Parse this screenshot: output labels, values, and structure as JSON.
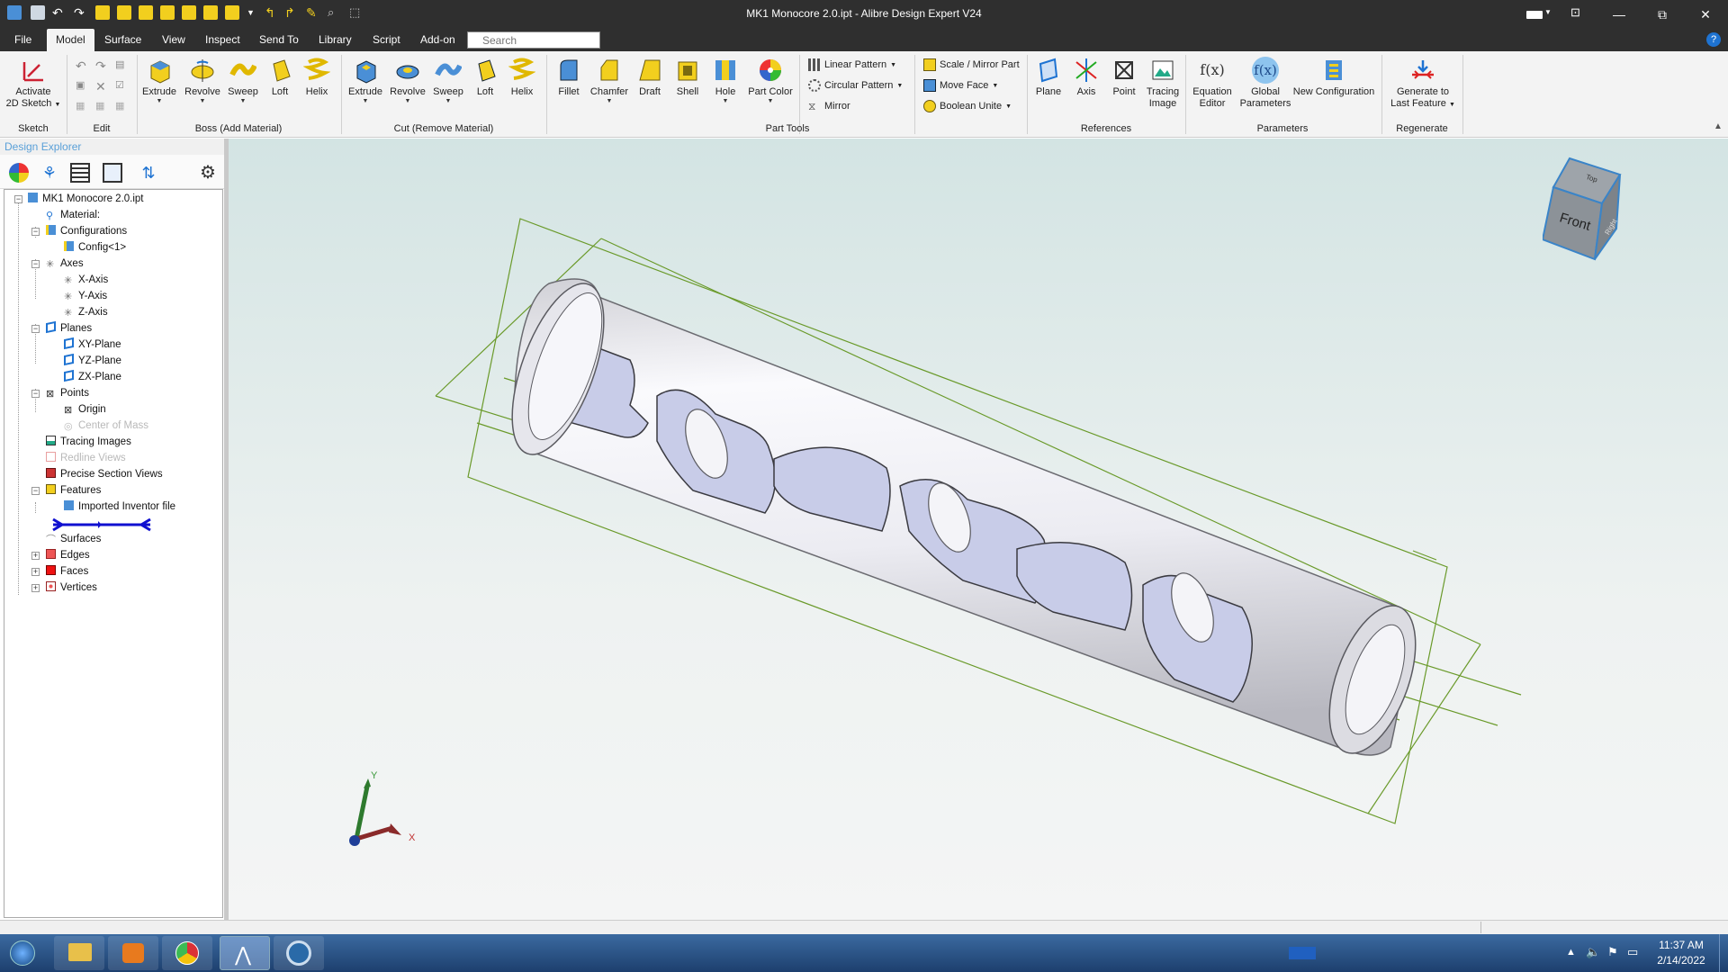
{
  "window": {
    "title": "MK1 Monocore 2.0.ipt - Alibre Design Expert V24",
    "controls": [
      "—",
      "⧉",
      "✕"
    ]
  },
  "menu": {
    "items": [
      "File",
      "Model",
      "Surface",
      "View",
      "Inspect",
      "Send To",
      "Library",
      "Script",
      "Add-on"
    ],
    "active": "Model",
    "search_placeholder": "Search"
  },
  "ribbon": {
    "sketch": {
      "activate_label": "Activate",
      "activate_label2": "2D Sketch"
    },
    "groups": [
      "Sketch",
      "Edit",
      "Boss (Add Material)",
      "Cut (Remove Material)",
      "Part Tools",
      "References",
      "Parameters",
      "Regenerate"
    ],
    "boss": [
      "Extrude",
      "Revolve",
      "Sweep",
      "Loft",
      "Helix"
    ],
    "cut": [
      "Extrude",
      "Revolve",
      "Sweep",
      "Loft",
      "Helix"
    ],
    "part_tools": [
      "Fillet",
      "Chamfer",
      "Draft",
      "Shell",
      "Hole",
      "Part Color"
    ],
    "pattern_tools": [
      "Linear Pattern",
      "Circular Pattern",
      "Mirror"
    ],
    "move_tools": [
      "Scale / Mirror Part",
      "Move Face",
      "Boolean Unite"
    ],
    "references": [
      "Plane",
      "Axis",
      "Point",
      "Tracing",
      "Image"
    ],
    "parameters": [
      "Equation",
      "Editor",
      "Global",
      "Parameters",
      "New Configuration"
    ],
    "regenerate": [
      "Generate to",
      "Last Feature"
    ]
  },
  "explorer": {
    "title": "Design Explorer",
    "tree": [
      {
        "label": "MK1 Monocore 2.0.ipt"
      },
      {
        "label": "Material:"
      },
      {
        "label": "Configurations"
      },
      {
        "label": "Config<1>"
      },
      {
        "label": "Axes"
      },
      {
        "label": "X-Axis"
      },
      {
        "label": "Y-Axis"
      },
      {
        "label": "Z-Axis"
      },
      {
        "label": "Planes"
      },
      {
        "label": "XY-Plane"
      },
      {
        "label": "YZ-Plane"
      },
      {
        "label": "ZX-Plane"
      },
      {
        "label": "Points"
      },
      {
        "label": "Origin"
      },
      {
        "label": "Center of Mass"
      },
      {
        "label": "Tracing Images"
      },
      {
        "label": "Redline Views"
      },
      {
        "label": "Precise Section Views"
      },
      {
        "label": "Features"
      },
      {
        "label": "Imported Inventor file"
      },
      {
        "label": "Surfaces"
      },
      {
        "label": "Edges"
      },
      {
        "label": "Faces"
      },
      {
        "label": "Vertices"
      }
    ]
  },
  "viewcube": {
    "front": "Front",
    "right": "Right",
    "top": "Top"
  },
  "triad": {
    "x": "X",
    "y": "Y"
  },
  "taskbar": {
    "time": "11:37 AM",
    "date": "2/14/2022"
  },
  "colors": {
    "accent": "#1e73d2",
    "titlebar": "#2f2f2f",
    "ribbon": "#f3f3f3",
    "sketch_green": "#6a9a2a"
  }
}
